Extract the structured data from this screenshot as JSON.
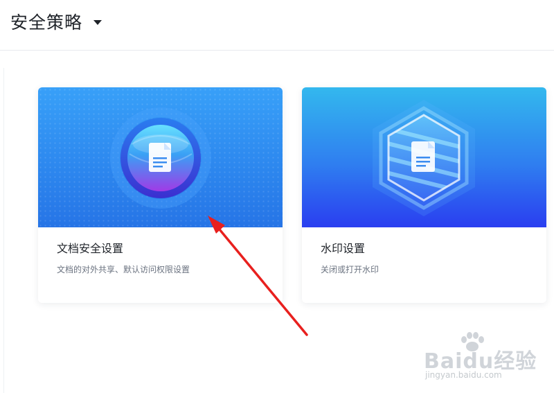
{
  "header": {
    "title": "安全策略"
  },
  "cards": [
    {
      "title": "文档安全设置",
      "description": "文档的对外共享、默认访问权限设置",
      "icon": "document-shield-globe-icon"
    },
    {
      "title": "水印设置",
      "description": "关闭或打开水印",
      "icon": "document-hexagon-watermark-icon"
    }
  ],
  "watermark": {
    "logo": "Baidu经验",
    "url": "jingyan.baidu.com"
  },
  "annotation": {
    "arrow_color": "#e8201e"
  },
  "colors": {
    "card1_banner": "#2c86ee",
    "card2_banner": "#2f7ef0",
    "text_primary": "#1f2329",
    "text_secondary": "#6b7380"
  }
}
